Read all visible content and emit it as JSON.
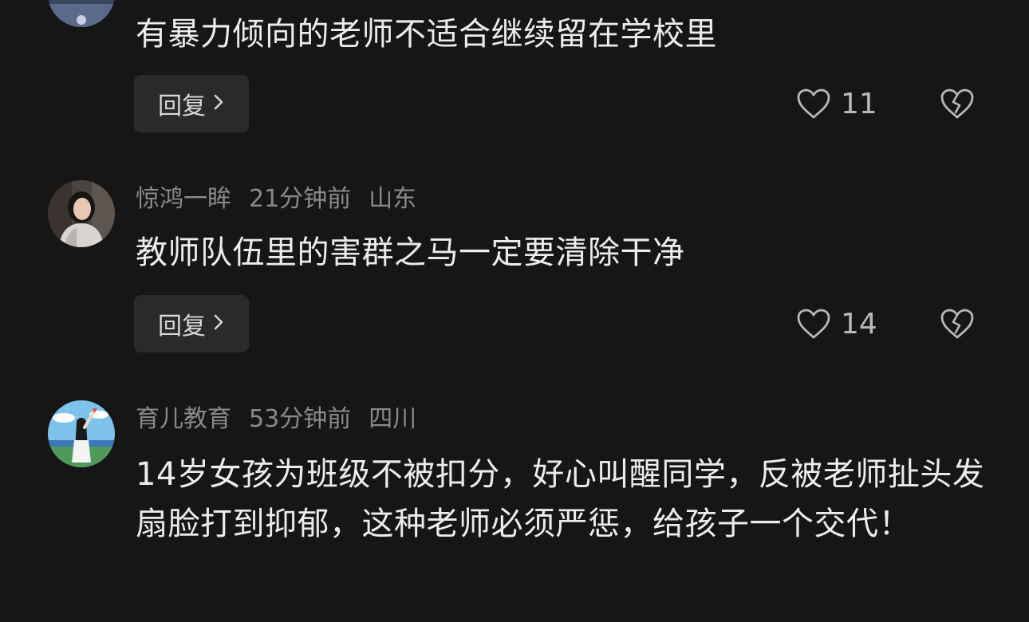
{
  "comments": [
    {
      "username": "",
      "time": "",
      "location": "",
      "text": "有暴力倾向的老师不适合继续留在学校里",
      "reply_label": "回复",
      "likes": "11",
      "avatar": "partial-avatar-icon"
    },
    {
      "username": "惊鸿一眸",
      "time": "21分钟前",
      "location": "山东",
      "text": "教师队伍里的害群之马一定要清除干净",
      "reply_label": "回复",
      "likes": "14",
      "avatar": "girl-photo-avatar-icon"
    },
    {
      "username": "育儿教育",
      "time": "53分钟前",
      "location": "四川",
      "text": "14岁女孩为班级不被扣分，好心叫醒同学，反被老师扯头发扇脸打到抑郁，这种老师必须严惩，给孩子一个交代！",
      "avatar": "illustrated-girl-avatar-icon"
    }
  ],
  "colors": {
    "background": "#161616",
    "meta_text": "#8a8a8a",
    "body_text": "#ececec",
    "reply_bg": "#2a2a2a"
  },
  "icons": {
    "like": "heart-icon",
    "dislike": "broken-heart-icon",
    "chevron": "chevron-right-icon"
  }
}
